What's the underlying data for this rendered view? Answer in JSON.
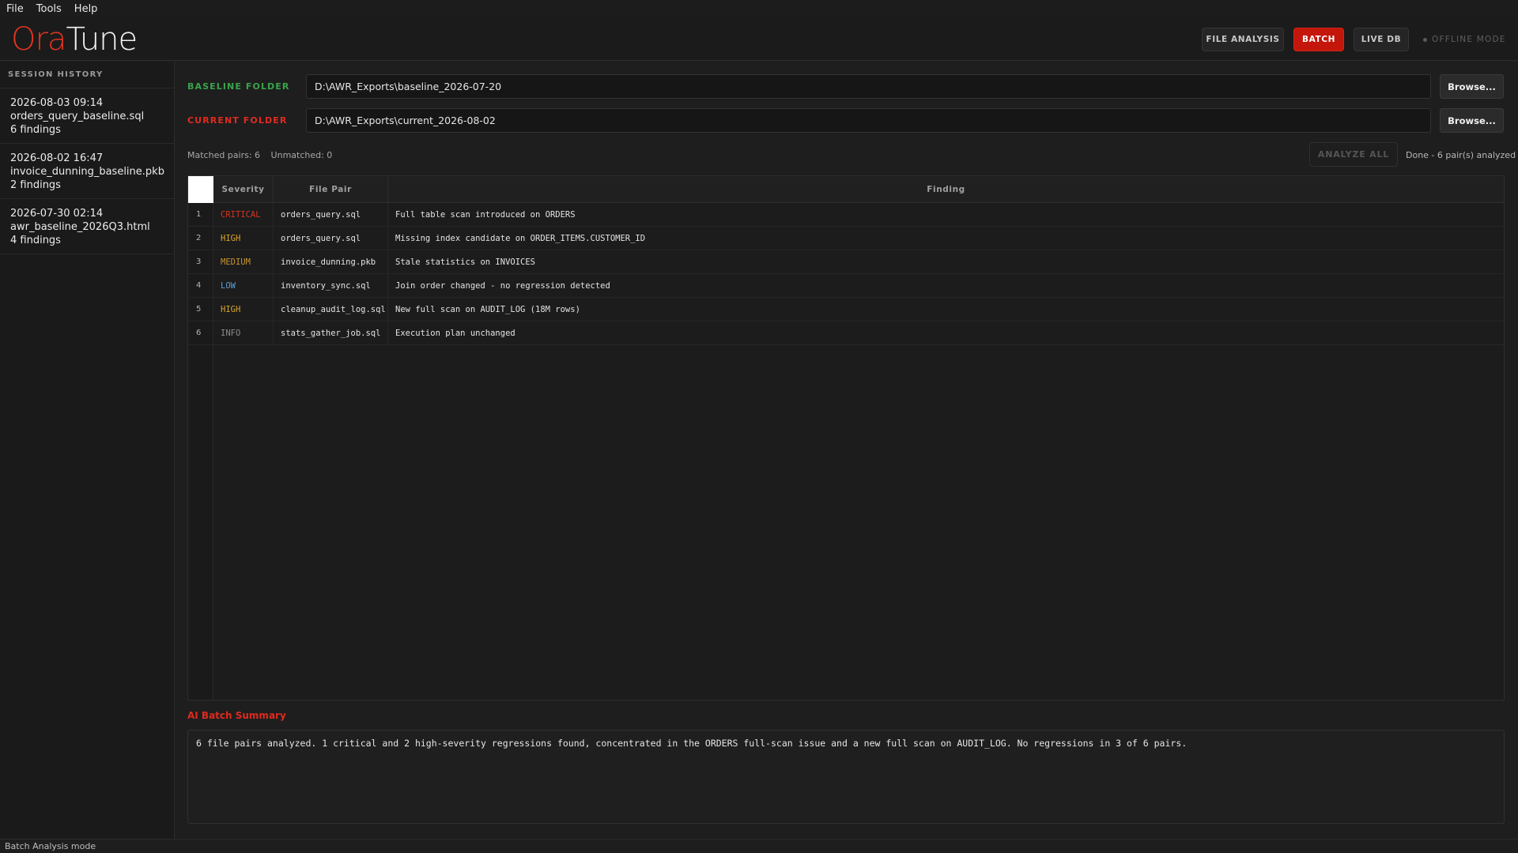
{
  "menu": [
    "File",
    "Tools",
    "Help"
  ],
  "app": {
    "logo_part1": "Ora",
    "logo_part2": "Tune"
  },
  "modes": [
    {
      "label": "FILE ANALYSIS",
      "active": false
    },
    {
      "label": "BATCH",
      "active": true
    },
    {
      "label": "LIVE DB",
      "active": false
    }
  ],
  "offline_label": "OFFLINE MODE",
  "sidebar": {
    "title": "SESSION HISTORY",
    "items": [
      {
        "timestamp": "2026-08-03 09:14",
        "file": "orders_query_baseline.sql",
        "findings": "6 findings"
      },
      {
        "timestamp": "2026-08-02 16:47",
        "file": "invoice_dunning_baseline.pkb",
        "findings": "2 findings"
      },
      {
        "timestamp": "2026-07-30 02:14",
        "file": "awr_baseline_2026Q3.html",
        "findings": "4 findings"
      }
    ]
  },
  "baseline": {
    "label": "BASELINE FOLDER",
    "value": "D:\\AWR_Exports\\baseline_2026-07-20",
    "browse": "Browse..."
  },
  "current": {
    "label": "CURRENT FOLDER",
    "value": "D:\\AWR_Exports\\current_2026-08-02",
    "browse": "Browse..."
  },
  "pairs": {
    "matched": "Matched pairs: 6",
    "unmatched": "Unmatched: 0"
  },
  "analyze_label": "ANALYZE ALL",
  "done_status": "Done - 6 pair(s) analyzed",
  "table": {
    "headers": [
      "Severity",
      "File Pair",
      "Finding"
    ],
    "rows": [
      {
        "num": "1",
        "severity": "CRITICAL",
        "file": "orders_query.sql",
        "finding": "Full table scan introduced on ORDERS"
      },
      {
        "num": "2",
        "severity": "HIGH",
        "file": "orders_query.sql",
        "finding": "Missing index candidate on ORDER_ITEMS.CUSTOMER_ID"
      },
      {
        "num": "3",
        "severity": "MEDIUM",
        "file": "invoice_dunning.pkb",
        "finding": "Stale statistics on INVOICES"
      },
      {
        "num": "4",
        "severity": "LOW",
        "file": "inventory_sync.sql",
        "finding": "Join order changed - no regression detected"
      },
      {
        "num": "5",
        "severity": "HIGH",
        "file": "cleanup_audit_log.sql",
        "finding": "New full scan on AUDIT_LOG (18M rows)"
      },
      {
        "num": "6",
        "severity": "INFO",
        "file": "stats_gather_job.sql",
        "finding": "Execution plan unchanged"
      }
    ]
  },
  "summary": {
    "title": "AI Batch Summary",
    "text": "6 file pairs analyzed. 1 critical and 2 high-severity regressions found, concentrated in the ORDERS full-scan issue and a new full scan on AUDIT_LOG. No regressions in 3 of 6 pairs."
  },
  "statusbar": "Batch Analysis mode",
  "colors": {
    "accent": "#c4160b",
    "baseline_label": "#3aa34d",
    "current_label": "#e02b1f",
    "critical": "#d8331f",
    "high": "#d9a62c",
    "medium": "#c8942c",
    "low": "#5b9fd6",
    "info": "#8a8a8a"
  }
}
